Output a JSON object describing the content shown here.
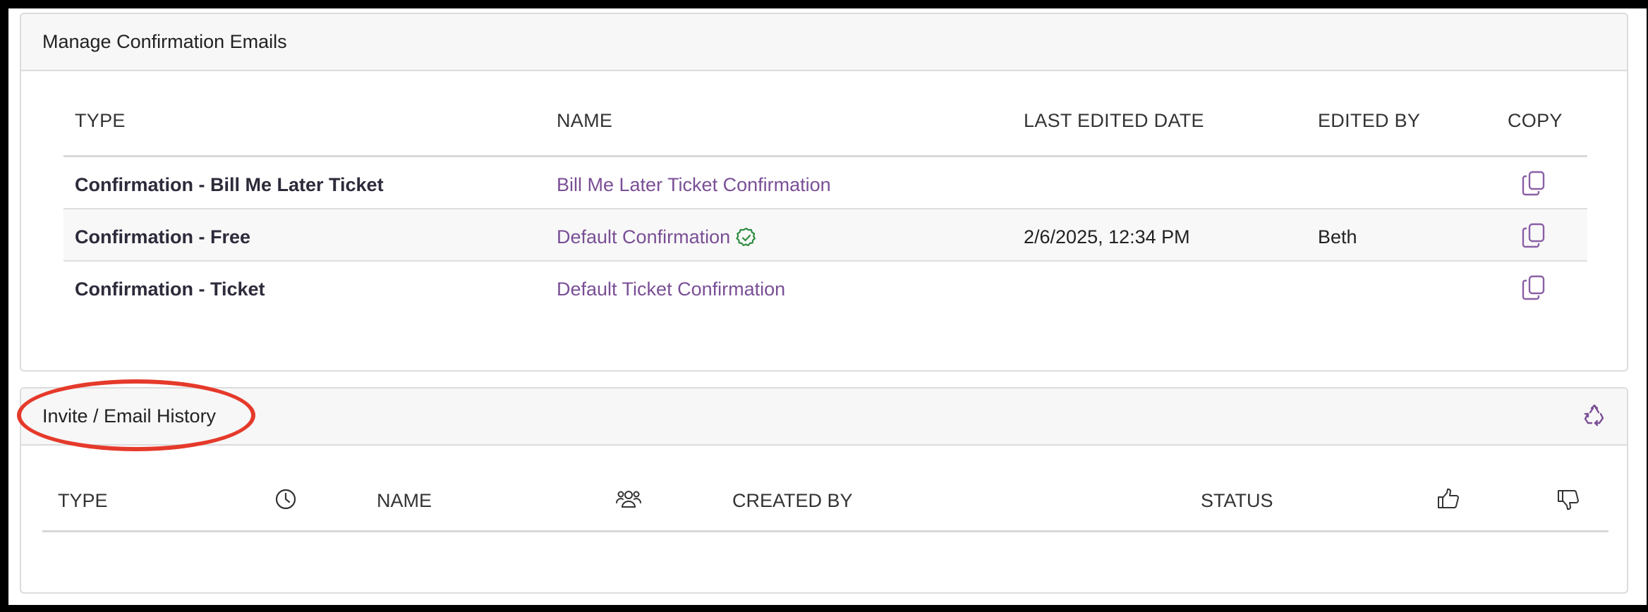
{
  "confirmation_panel": {
    "title": "Manage Confirmation Emails",
    "columns": {
      "type": "TYPE",
      "name": "NAME",
      "last_edited": "LAST EDITED DATE",
      "edited_by": "EDITED BY",
      "copy": "COPY"
    },
    "rows": [
      {
        "type": "Confirmation - Bill Me Later Ticket",
        "name": "Bill Me Later Ticket Confirmation",
        "last_edited": "",
        "edited_by": "",
        "default": false
      },
      {
        "type": "Confirmation - Free",
        "name": "Default Confirmation",
        "last_edited": "2/6/2025, 12:34 PM",
        "edited_by": "Beth",
        "default": true
      },
      {
        "type": "Confirmation - Ticket",
        "name": "Default Ticket Confirmation",
        "last_edited": "",
        "edited_by": "",
        "default": false
      }
    ]
  },
  "history_panel": {
    "title": "Invite / Email History",
    "refresh_icon": "recycle-icon",
    "columns": {
      "type": "TYPE",
      "time_icon": "clock-icon",
      "name": "NAME",
      "recipients_icon": "people-icon",
      "created_by": "CREATED BY",
      "status": "STATUS",
      "likes_icon": "thumbs-up-icon",
      "dislikes_icon": "thumbs-down-icon"
    },
    "rows": []
  },
  "colors": {
    "link": "#7a4f96",
    "annotation": "#e53a2b",
    "check": "#2e8b3e"
  }
}
